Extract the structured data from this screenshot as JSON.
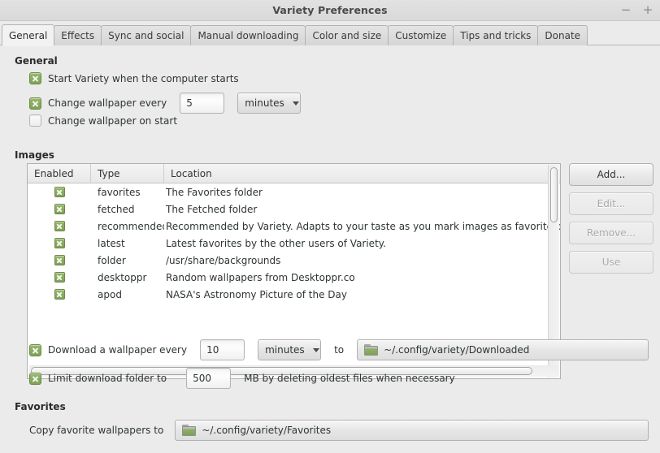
{
  "window": {
    "title": "Variety Preferences",
    "minimize_label": "−",
    "maximize_label": "+"
  },
  "tabs": [
    {
      "label": "General",
      "active": true
    },
    {
      "label": "Effects",
      "active": false
    },
    {
      "label": "Sync and social",
      "active": false
    },
    {
      "label": "Manual downloading",
      "active": false
    },
    {
      "label": "Color and size",
      "active": false
    },
    {
      "label": "Customize",
      "active": false
    },
    {
      "label": "Tips and tricks",
      "active": false
    },
    {
      "label": "Donate",
      "active": false
    }
  ],
  "general": {
    "heading": "General",
    "start_on_boot": {
      "label": "Start Variety when the computer starts",
      "checked": true
    },
    "change_every": {
      "label": "Change wallpaper every",
      "checked": true,
      "value": "5",
      "unit": "minutes"
    },
    "change_on_start": {
      "label": "Change wallpaper on start",
      "checked": false
    }
  },
  "images": {
    "heading": "Images",
    "columns": [
      "Enabled",
      "Type",
      "Location"
    ],
    "rows": [
      {
        "enabled": true,
        "type": "favorites",
        "location": "The Favorites folder"
      },
      {
        "enabled": true,
        "type": "fetched",
        "location": "The Fetched folder"
      },
      {
        "enabled": true,
        "type": "recommended",
        "location": "Recommended by Variety. Adapts to your taste as you mark images as favorite or tra"
      },
      {
        "enabled": true,
        "type": "latest",
        "location": "Latest favorites by the other users of Variety."
      },
      {
        "enabled": true,
        "type": "folder",
        "location": "/usr/share/backgrounds"
      },
      {
        "enabled": true,
        "type": "desktoppr",
        "location": "Random wallpapers from Desktoppr.co"
      },
      {
        "enabled": true,
        "type": "apod",
        "location": "NASA's Astronomy Picture of the Day"
      }
    ],
    "buttons": [
      {
        "label": "Add...",
        "enabled": true
      },
      {
        "label": "Edit...",
        "enabled": false
      },
      {
        "label": "Remove...",
        "enabled": false
      },
      {
        "label": "Use",
        "enabled": false
      }
    ]
  },
  "download": {
    "every": {
      "label": "Download a wallpaper every",
      "checked": true,
      "value": "10",
      "unit": "minutes",
      "to_label": "to",
      "path": "~/.config/variety/Downloaded",
      "folder_icon": "folder-icon"
    },
    "limit": {
      "label": "Limit download folder to",
      "checked": true,
      "value": "500",
      "suffix": "MB by deleting oldest files when necessary"
    }
  },
  "favorites": {
    "heading": "Favorites",
    "copy_label": "Copy favorite wallpapers to",
    "path": "~/.config/variety/Favorites",
    "folder_icon": "folder-icon"
  }
}
